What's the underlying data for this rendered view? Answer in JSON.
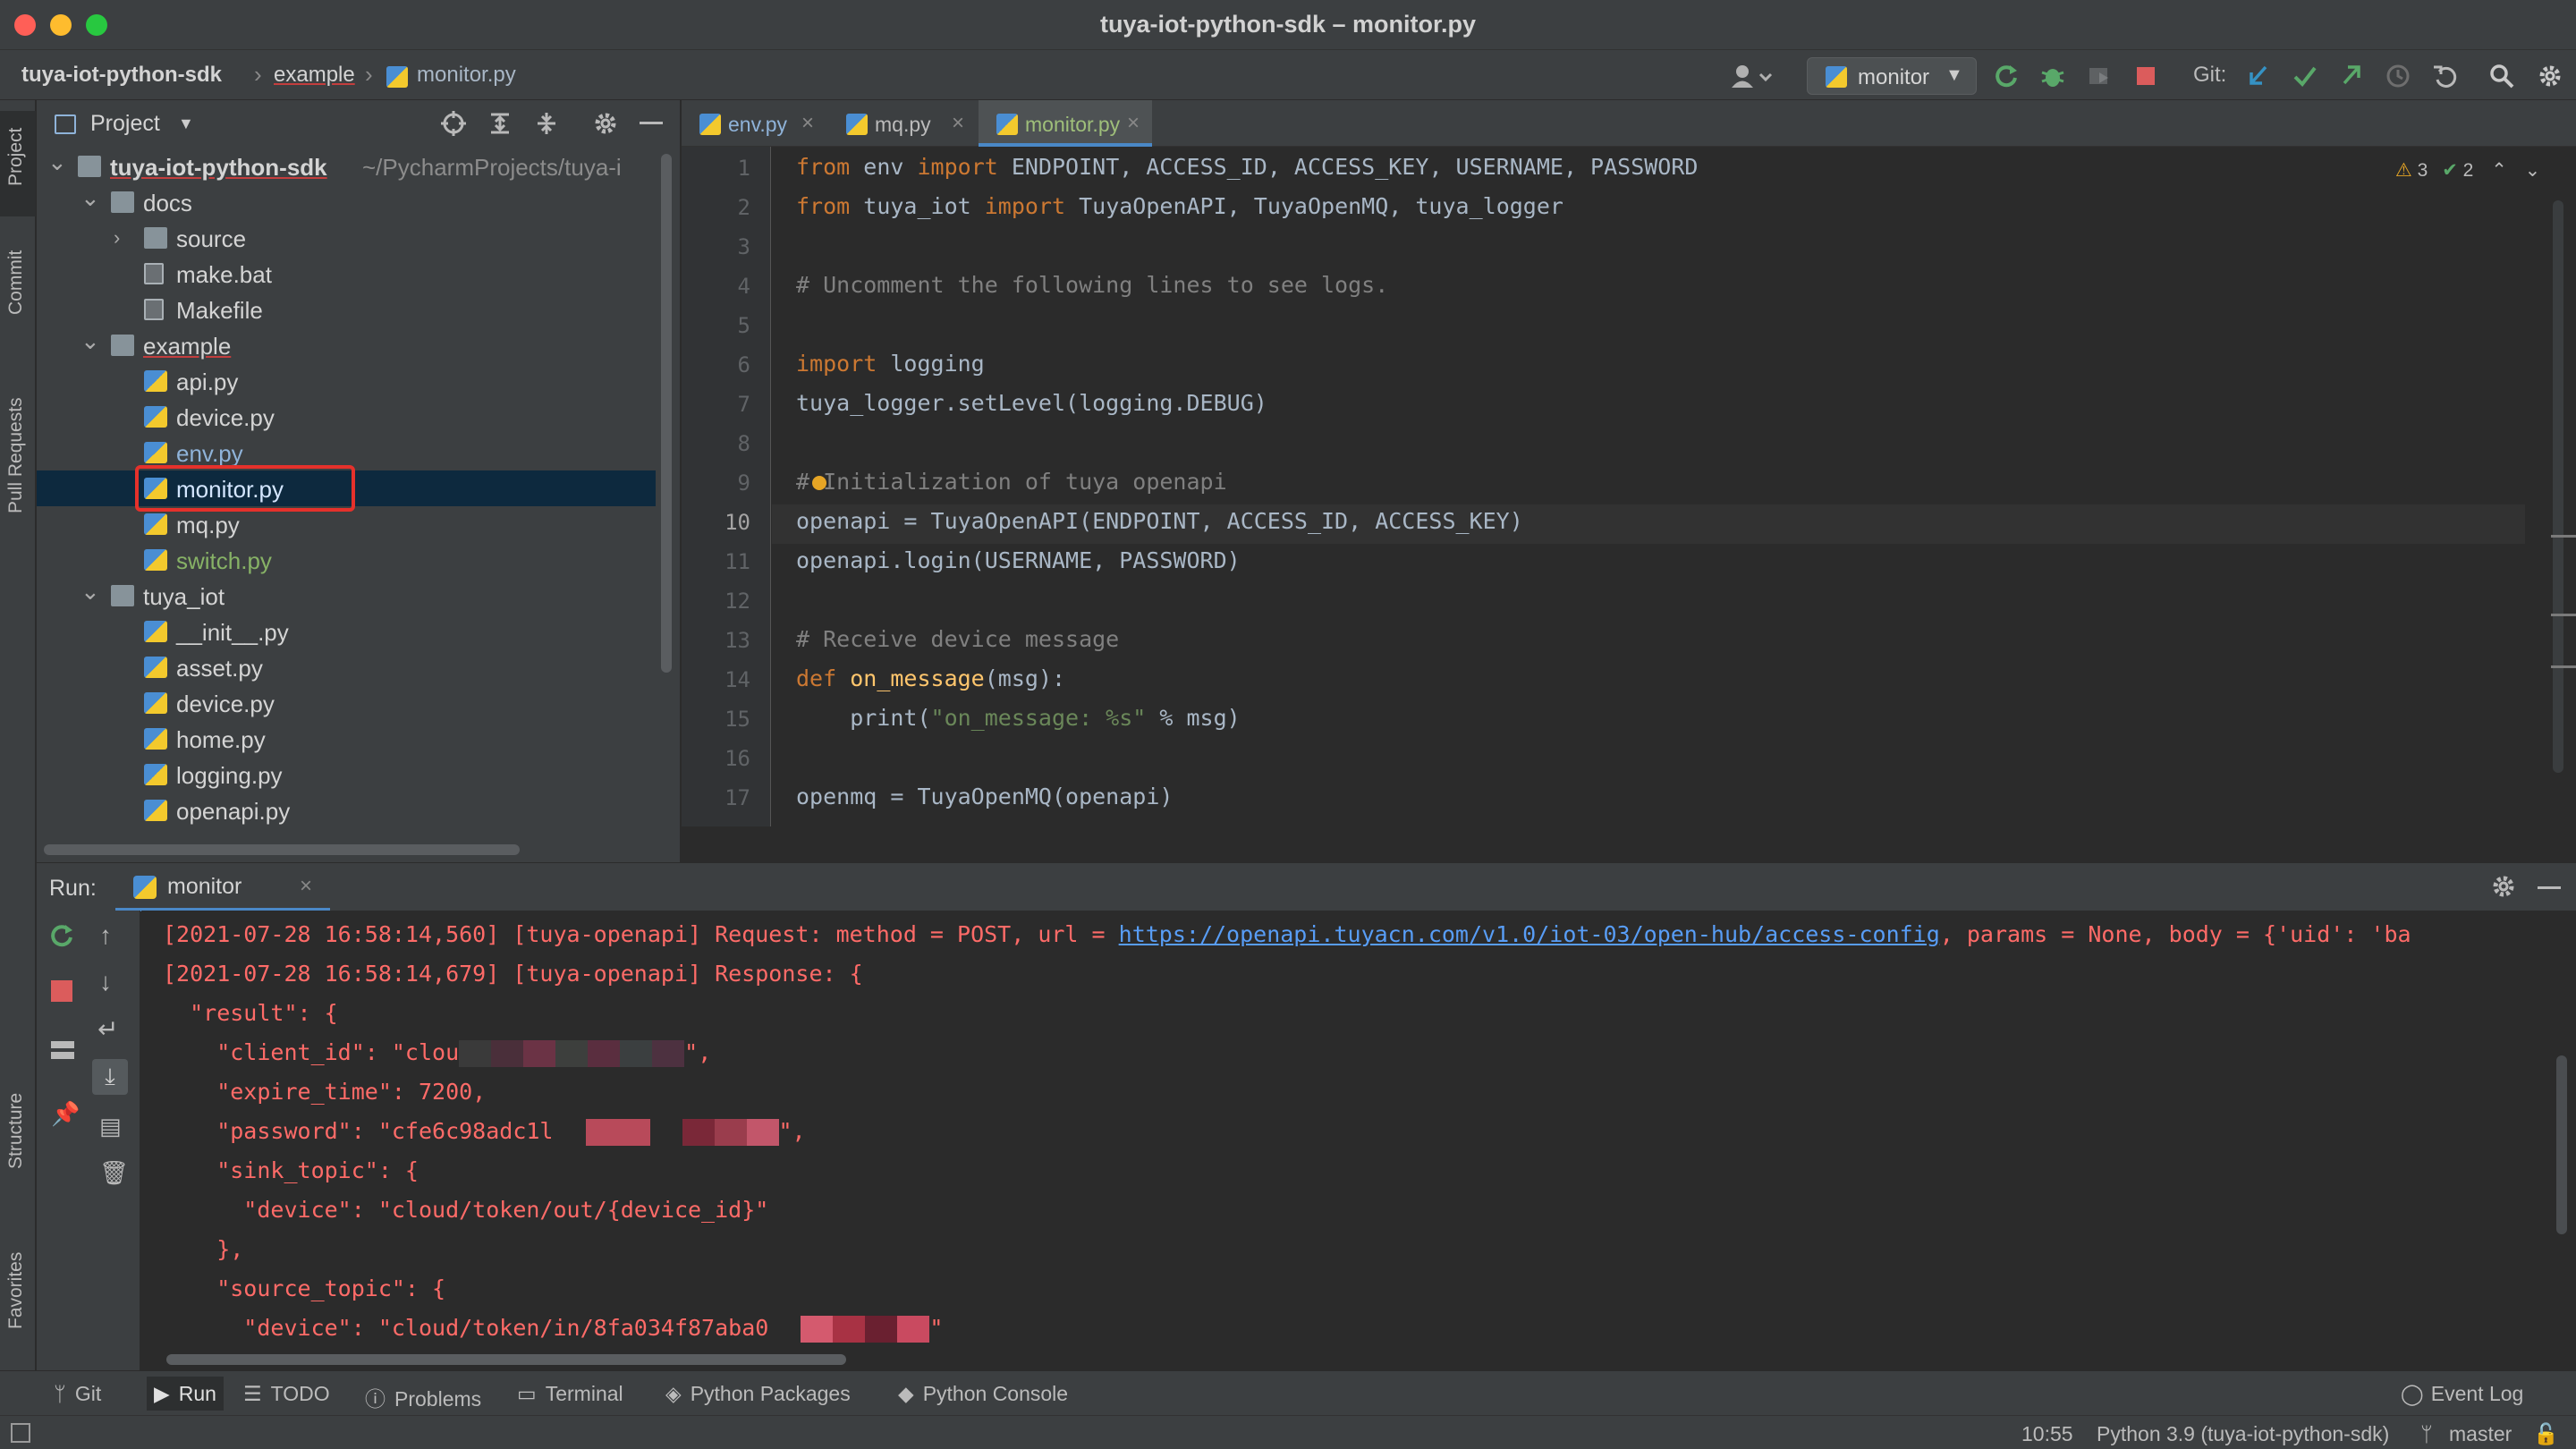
{
  "window": {
    "title": "tuya-iot-python-sdk – monitor.py"
  },
  "breadcrumb": {
    "root": "tuya-iot-python-sdk",
    "folder": "example",
    "file": "monitor.py"
  },
  "toolbar": {
    "run_config": "monitor",
    "git_label": "Git:"
  },
  "left_strip": {
    "project": "Project",
    "commit": "Commit",
    "pull_requests": "Pull Requests",
    "structure": "Structure",
    "favorites": "Favorites"
  },
  "project_panel": {
    "title": "Project",
    "tree": [
      {
        "label": "tuya-iot-python-sdk",
        "suffix": "~/PycharmProjects/tuya-i",
        "kind": "folder",
        "depth": 0,
        "open": true
      },
      {
        "label": "docs",
        "kind": "folder",
        "depth": 1,
        "open": true
      },
      {
        "label": "source",
        "kind": "folder",
        "depth": 2,
        "open": false
      },
      {
        "label": "make.bat",
        "kind": "file",
        "depth": 2
      },
      {
        "label": "Makefile",
        "kind": "file",
        "depth": 2
      },
      {
        "label": "example",
        "kind": "folder",
        "depth": 1,
        "open": true
      },
      {
        "label": "api.py",
        "kind": "py",
        "depth": 2
      },
      {
        "label": "device.py",
        "kind": "py",
        "depth": 2
      },
      {
        "label": "env.py",
        "kind": "py",
        "depth": 2
      },
      {
        "label": "monitor.py",
        "kind": "py",
        "depth": 2,
        "selected": true
      },
      {
        "label": "mq.py",
        "kind": "py",
        "depth": 2
      },
      {
        "label": "switch.py",
        "kind": "py",
        "depth": 2
      },
      {
        "label": "tuya_iot",
        "kind": "folder",
        "depth": 1,
        "open": true
      },
      {
        "label": "__init__.py",
        "kind": "py",
        "depth": 2
      },
      {
        "label": "asset.py",
        "kind": "py",
        "depth": 2
      },
      {
        "label": "device.py",
        "kind": "py",
        "depth": 2
      },
      {
        "label": "home.py",
        "kind": "py",
        "depth": 2
      },
      {
        "label": "logging.py",
        "kind": "py",
        "depth": 2
      },
      {
        "label": "openapi.py",
        "kind": "py",
        "depth": 2
      }
    ]
  },
  "editor": {
    "tabs": [
      {
        "label": "env.py",
        "active": false
      },
      {
        "label": "mq.py",
        "active": false
      },
      {
        "label": "monitor.py",
        "active": true
      }
    ],
    "inspections": {
      "warnings": "3",
      "ok": "2"
    },
    "lines": [
      {
        "n": "1",
        "html": "<span class='kw'>from</span> env <span class='kw'>import</span> ENDPOINT, ACCESS_ID, ACCESS_KEY, USERNAME, PASSWORD"
      },
      {
        "n": "2",
        "html": "<span class='kw'>from</span> tuya_iot <span class='kw'>import</span> TuyaOpenAPI, TuyaOpenMQ, tuya_logger"
      },
      {
        "n": "3",
        "html": ""
      },
      {
        "n": "4",
        "html": "<span class='cm'># Uncomment the following lines to see logs.</span>"
      },
      {
        "n": "5",
        "html": ""
      },
      {
        "n": "6",
        "html": "<span class='kw'>import</span> logging"
      },
      {
        "n": "7",
        "html": "tuya_logger.setLevel(logging.DEBUG)"
      },
      {
        "n": "8",
        "html": ""
      },
      {
        "n": "9",
        "html": "<span class='cm'># Initialization of tuya openapi</span>"
      },
      {
        "n": "10",
        "html": "openapi = TuyaOpenAPI(ENDPOINT, ACCESS_ID, ACCESS_KEY)"
      },
      {
        "n": "11",
        "html": "openapi.login(USERNAME, PASSWORD)"
      },
      {
        "n": "12",
        "html": ""
      },
      {
        "n": "13",
        "html": "<span class='cm'># Receive device message</span>"
      },
      {
        "n": "14",
        "html": "<span class='kw'>def</span> <span class='fn'>on_message</span>(msg):"
      },
      {
        "n": "15",
        "html": "    print(<span class='st'>\"on_message: %s\"</span> % msg)"
      },
      {
        "n": "16",
        "html": ""
      },
      {
        "n": "17",
        "html": "openmq = TuyaOpenMQ(openapi)"
      }
    ]
  },
  "run_panel": {
    "label": "Run:",
    "tab": "monitor",
    "console": [
      {
        "pre": "[2021-07-28 16:58:14,560] [tuya-openapi] Request: method = POST, url = ",
        "link": "https://openapi.tuyacn.com/v1.0/iot-03/open-hub/access-config",
        "post": ", params = None, body = {'uid': 'ba"
      },
      {
        "pre": "[2021-07-28 16:58:14,679] [tuya-openapi] Response: {"
      },
      {
        "pre": "  \"result\": {"
      },
      {
        "pre": "    \"client_id\": \"clou",
        "post": "\","
      },
      {
        "pre": "    \"expire_time\": 7200,"
      },
      {
        "pre": "    \"password\": \"cfe6c98adc1l",
        "post": "\","
      },
      {
        "pre": "    \"sink_topic\": {"
      },
      {
        "pre": "      \"device\": \"cloud/token/out/{device_id}\""
      },
      {
        "pre": "    },"
      },
      {
        "pre": "    \"source_topic\": {"
      },
      {
        "pre": "      \"device\": \"cloud/token/in/8fa034f87aba0",
        "post": "\""
      }
    ]
  },
  "bottom_tools": [
    "Git",
    "Run",
    "TODO",
    "Problems",
    "Terminal",
    "Python Packages",
    "Python Console"
  ],
  "event_log": "Event Log",
  "status": {
    "position": "10:55",
    "interpreter": "Python 3.9 (tuya-iot-python-sdk)",
    "branch": "master"
  }
}
